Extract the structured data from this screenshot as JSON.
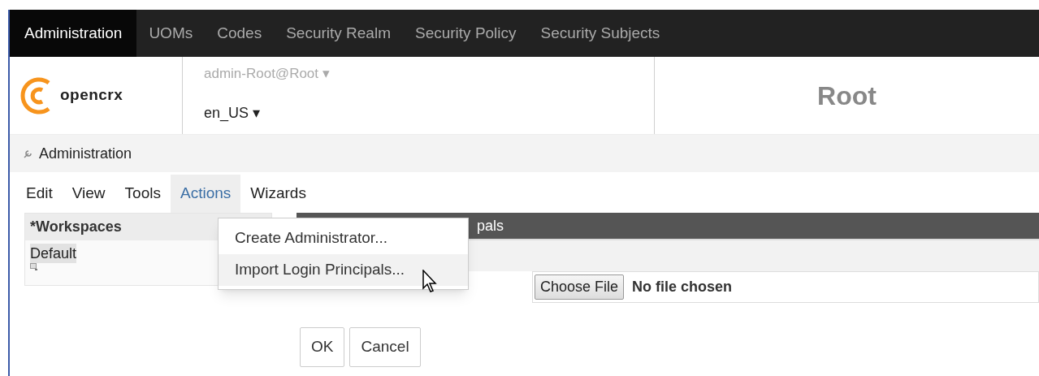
{
  "nav_tabs": [
    {
      "label": "Administration",
      "selected": true
    },
    {
      "label": "UOMs",
      "selected": false
    },
    {
      "label": "Codes",
      "selected": false
    },
    {
      "label": "Security Realm",
      "selected": false
    },
    {
      "label": "Security Policy",
      "selected": false
    },
    {
      "label": "Security Subjects",
      "selected": false
    }
  ],
  "header": {
    "logo_text": "opencrx",
    "user": "admin-Root@Root",
    "user_caret": "▾",
    "locale": "en_US",
    "locale_caret": "▾",
    "segment": "Root"
  },
  "breadcrumb": "Administration",
  "menu_bar": [
    {
      "label": "Edit",
      "selected": false
    },
    {
      "label": "View",
      "selected": false
    },
    {
      "label": "Tools",
      "selected": false
    },
    {
      "label": "Actions",
      "selected": true
    },
    {
      "label": "Wizards",
      "selected": false
    }
  ],
  "workspaces": {
    "title": "*Workspaces",
    "items": [
      "Default"
    ]
  },
  "dialog": {
    "title_visible": "pals",
    "file_button": "Choose File",
    "file_status": "No file chosen",
    "buttons": [
      "OK",
      "Cancel"
    ]
  },
  "dropdown": [
    {
      "label": "Create Administrator...",
      "selected": false
    },
    {
      "label": "Import Login Principals...",
      "selected": true
    }
  ]
}
